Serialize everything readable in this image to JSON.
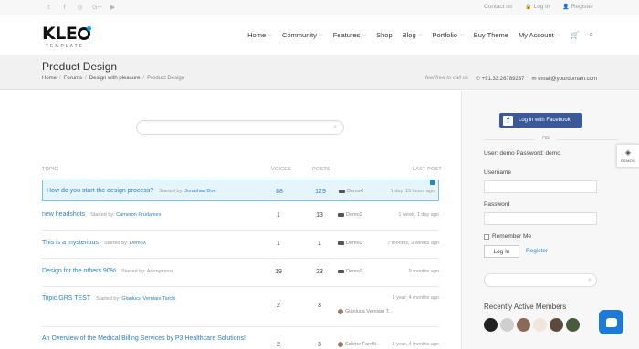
{
  "topbar": {
    "social_icons": [
      "twitter-icon",
      "facebook-icon",
      "dribbble-icon",
      "google-plus-icon",
      "youtube-icon"
    ],
    "links": {
      "contact": "Contact us",
      "login": "Log in",
      "register": "Register"
    }
  },
  "header": {
    "logo_text": "KLEO",
    "logo_sub": "TEMPLATE",
    "nav": [
      "Home",
      "Community",
      "Features",
      "Shop",
      "Blog",
      "Portfolio",
      "Buy Theme",
      "My Account"
    ]
  },
  "title_band": {
    "title": "Product Design",
    "breadcrumb": [
      "Home",
      "Forums",
      "Design with pleasure",
      "Product Design"
    ],
    "tagline": "feel free to call us",
    "phone": "+91.33.26789237",
    "email": "email@yourdomain.com"
  },
  "forum": {
    "columns": {
      "topic": "TOPIC",
      "voices": "VOICES",
      "posts": "POSTS",
      "last_post": "LAST POST"
    },
    "topics": [
      {
        "title": "How do you start the design process?",
        "started_by_label": "Started by:",
        "author": "Jonathan Doe",
        "voices": "88",
        "posts": "129",
        "last_user": "DemoX",
        "last_time": "1 day, 19 hours ago",
        "highlight": true
      },
      {
        "title": "new headshots",
        "started_by_label": "Started by:",
        "author": "Cameron Prudames",
        "voices": "1",
        "posts": "13",
        "last_user": "DemoX",
        "last_time": "1 week, 1 day ago"
      },
      {
        "title": "This is a mysterious",
        "started_by_label": "Started by:",
        "author": "DemoX",
        "voices": "1",
        "posts": "1",
        "last_user": "DemoX",
        "last_time": "7 months, 3 weeks ago"
      },
      {
        "title": "Design for the others 90%",
        "started_by_label": "Started by:",
        "author": "Anonymous",
        "voices": "19",
        "posts": "23",
        "last_user": "DemoX",
        "last_time": "9 months ago"
      },
      {
        "title": "Topic GRS TEST",
        "started_by_label": "Started by:",
        "author": "Gianluca Verniani Tarchi",
        "voices": "2",
        "posts": "3",
        "last_user": "Gianluca Verniani T...",
        "last_time": "1 year, 4 months ago"
      },
      {
        "title": "An Overview of the Medical Billing Services by P3 Healthcare Solutions!",
        "started_by_label": "",
        "author": "",
        "voices": "2",
        "posts": "3",
        "last_user": "Selene Farolfi",
        "last_time": "1 year, 4 months ago"
      }
    ]
  },
  "sidebar": {
    "facebook_button": "Log in with Facebook",
    "or": "OR",
    "demo_credentials": "User: demo Password: demo",
    "username_label": "Username",
    "password_label": "Password",
    "remember_label": "Remember Me",
    "login_button": "Log In",
    "register_link": "Register",
    "recent_members_title": "Recently Active Members"
  },
  "float_tab": {
    "label": "DEMOS"
  },
  "colors": {
    "accent": "#2a84c6",
    "facebook": "#3b5998",
    "chat": "#1f7ad6",
    "logo_dot": "#00a8e6"
  }
}
